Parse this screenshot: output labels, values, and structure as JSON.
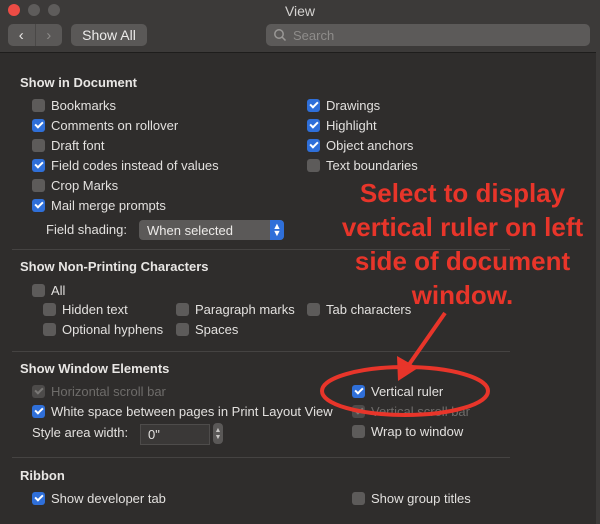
{
  "window": {
    "title": "View",
    "back_label": "‹",
    "forward_label": "›",
    "show_all_label": "Show All",
    "search_placeholder": "Search"
  },
  "show_in_document": {
    "title": "Show in Document",
    "left": [
      {
        "label": "Bookmarks",
        "checked": false
      },
      {
        "label": "Comments on rollover",
        "checked": true
      },
      {
        "label": "Draft font",
        "checked": false
      },
      {
        "label": "Field codes instead of values",
        "checked": true
      },
      {
        "label": "Crop Marks",
        "checked": false
      },
      {
        "label": "Mail merge prompts",
        "checked": true
      }
    ],
    "right": [
      {
        "label": "Drawings",
        "checked": true
      },
      {
        "label": "Highlight",
        "checked": true
      },
      {
        "label": "Object anchors",
        "checked": true
      },
      {
        "label": "Text boundaries",
        "checked": false
      }
    ],
    "field_shading_label": "Field shading:",
    "field_shading_value": "When selected"
  },
  "non_printing": {
    "title": "Show Non-Printing Characters",
    "all": {
      "label": "All",
      "checked": false
    },
    "items": [
      {
        "label": "Hidden text",
        "checked": false
      },
      {
        "label": "Paragraph marks",
        "checked": false
      },
      {
        "label": "Tab characters",
        "checked": false
      },
      {
        "label": "Optional hyphens",
        "checked": false
      },
      {
        "label": "Spaces",
        "checked": false
      }
    ]
  },
  "window_elements": {
    "title": "Show Window Elements",
    "horizontal_scroll": {
      "label": "Horizontal scroll bar",
      "checked": true,
      "disabled": true
    },
    "white_space": {
      "label": "White space between pages in Print Layout View",
      "checked": true
    },
    "style_area_label": "Style area width:",
    "style_area_value": "0\"",
    "vertical_ruler": {
      "label": "Vertical ruler",
      "checked": true
    },
    "vertical_scroll": {
      "label": "Vertical scroll bar",
      "checked": true,
      "disabled": true
    },
    "wrap_to_window": {
      "label": "Wrap to window",
      "checked": false
    }
  },
  "ribbon": {
    "title": "Ribbon",
    "developer_tab": {
      "label": "Show developer tab",
      "checked": true
    },
    "group_titles": {
      "label": "Show group titles",
      "checked": false
    }
  },
  "annotation": {
    "text": "Select to display vertical ruler on left side of document window.",
    "color": "#e8352a"
  },
  "colors": {
    "accent": "#2f6fd9",
    "background": "#2f2d2c"
  }
}
